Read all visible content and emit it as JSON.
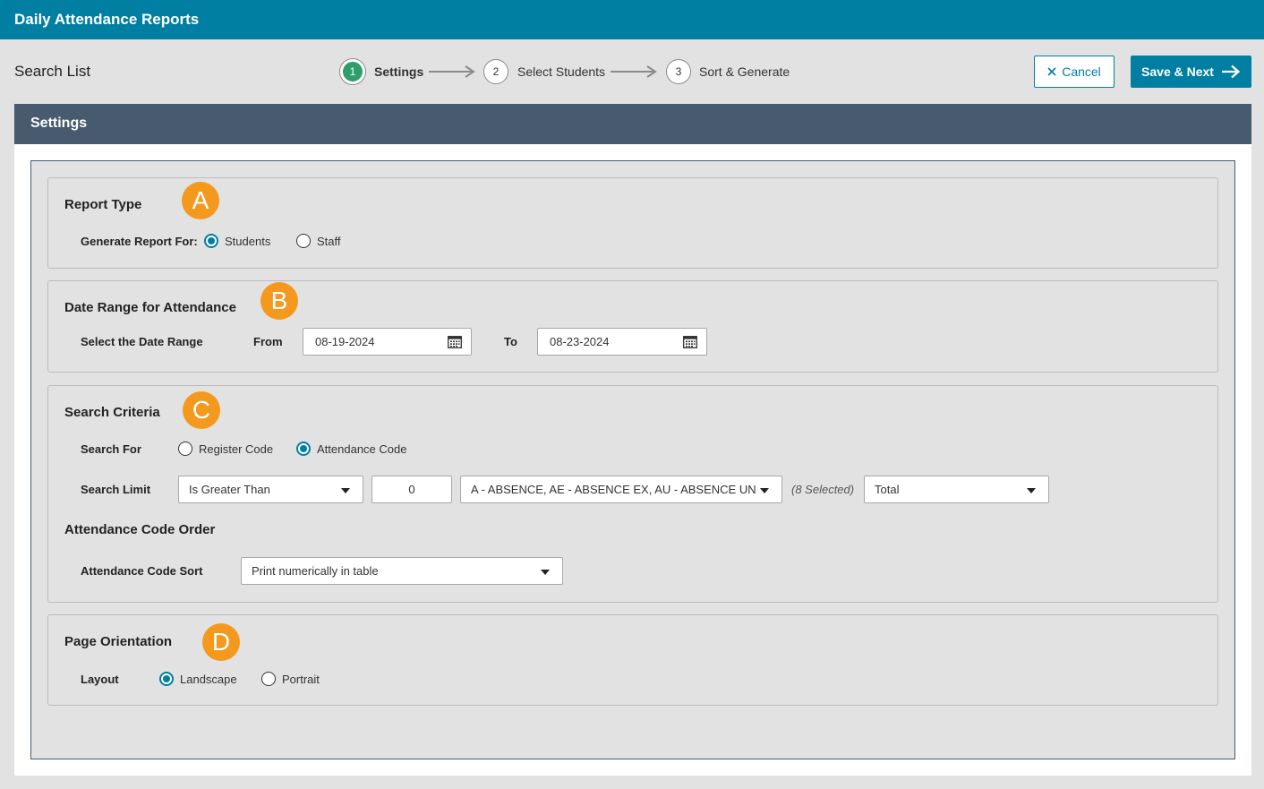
{
  "app": {
    "title": "Daily Attendance Reports"
  },
  "page": {
    "title": "Search List"
  },
  "stepper": {
    "steps": [
      {
        "number": "1",
        "label": "Settings"
      },
      {
        "number": "2",
        "label": "Select Students"
      },
      {
        "number": "3",
        "label": "Sort & Generate"
      }
    ]
  },
  "actions": {
    "cancel_label": "Cancel",
    "save_next_label": "Save & Next"
  },
  "panel": {
    "title": "Settings"
  },
  "report_type": {
    "title": "Report Type",
    "badge": "A",
    "generate_for_label": "Generate Report For:",
    "options": [
      "Students",
      "Staff"
    ],
    "selected": "Students"
  },
  "date_range": {
    "title": "Date Range for Attendance",
    "badge": "B",
    "label": "Select the Date Range",
    "from_label": "From",
    "from_value": "08-19-2024",
    "to_label": "To",
    "to_value": "08-23-2024"
  },
  "search_criteria": {
    "title": "Search Criteria",
    "badge": "C",
    "search_for_label": "Search For",
    "search_for_options": [
      "Register Code",
      "Attendance Code"
    ],
    "search_for_selected": "Attendance Code",
    "search_limit_label": "Search Limit",
    "comparison": "Is Greater Than",
    "limit_value": "0",
    "codes": "A - ABSENCE, AE - ABSENCE EX, AU - ABSENCE UN, ...",
    "selected_count": "(8 Selected)",
    "aggregate": "Total"
  },
  "code_order": {
    "title": "Attendance Code Order",
    "sort_label": "Attendance Code Sort",
    "sort_value": "Print numerically in table"
  },
  "page_orientation": {
    "title": "Page Orientation",
    "badge": "D",
    "layout_label": "Layout",
    "options": [
      "Landscape",
      "Portrait"
    ],
    "selected": "Landscape"
  },
  "colors": {
    "brand": "#007fa3",
    "panel_header": "#475a6e",
    "badge": "#f39a1e",
    "step_active": "#2e9e6a"
  }
}
